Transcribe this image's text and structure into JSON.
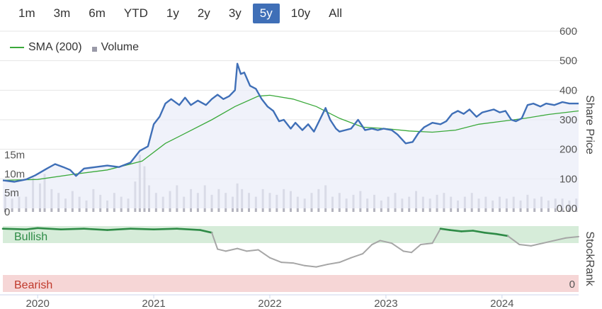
{
  "range_buttons": [
    "1m",
    "3m",
    "6m",
    "YTD",
    "1y",
    "2y",
    "3y",
    "5y",
    "10y",
    "All"
  ],
  "active_range": "5y",
  "legend": {
    "sma_label": "SMA (200)",
    "volume_label": "Volume"
  },
  "colors": {
    "price_line": "#3f6fb7",
    "sma_line": "#3aa93a",
    "volume_bars": "#9a9aa8",
    "bullish_band": "#d6ecd9",
    "bearish_band": "#f6d6d6",
    "bullish_text": "#2e8b46",
    "bearish_text": "#c0392b",
    "rank_bullish_line": "#2e8b46",
    "rank_neutral_line": "#a6a6a6"
  },
  "chart_data": {
    "type": "line",
    "right_axis_title": "Share Price",
    "right_axis_ticks": [
      "600",
      "500",
      "400",
      "300",
      "200",
      "100",
      "0.00"
    ],
    "ylim": [
      0,
      600
    ],
    "volume_axis_ticks": [
      "15m",
      "10m",
      "5m",
      "0"
    ],
    "volume_lim": [
      0,
      25
    ],
    "x_ticks": [
      "2020",
      "2021",
      "2022",
      "2023",
      "2024"
    ],
    "xlim": [
      2019.7,
      2024.66
    ],
    "price_series": {
      "points": [
        [
          2019.7,
          95
        ],
        [
          2019.8,
          90
        ],
        [
          2019.9,
          98
        ],
        [
          2019.98,
          112
        ],
        [
          2020.08,
          135
        ],
        [
          2020.15,
          150
        ],
        [
          2020.22,
          140
        ],
        [
          2020.28,
          130
        ],
        [
          2020.33,
          110
        ],
        [
          2020.4,
          135
        ],
        [
          2020.5,
          140
        ],
        [
          2020.6,
          145
        ],
        [
          2020.7,
          140
        ],
        [
          2020.8,
          155
        ],
        [
          2020.88,
          195
        ],
        [
          2020.95,
          210
        ],
        [
          2021.0,
          285
        ],
        [
          2021.05,
          310
        ],
        [
          2021.1,
          355
        ],
        [
          2021.15,
          370
        ],
        [
          2021.22,
          350
        ],
        [
          2021.27,
          375
        ],
        [
          2021.32,
          350
        ],
        [
          2021.38,
          365
        ],
        [
          2021.45,
          350
        ],
        [
          2021.5,
          370
        ],
        [
          2021.55,
          385
        ],
        [
          2021.6,
          370
        ],
        [
          2021.65,
          380
        ],
        [
          2021.7,
          400
        ],
        [
          2021.72,
          490
        ],
        [
          2021.75,
          455
        ],
        [
          2021.78,
          460
        ],
        [
          2021.83,
          415
        ],
        [
          2021.88,
          405
        ],
        [
          2021.93,
          370
        ],
        [
          2021.98,
          345
        ],
        [
          2022.03,
          330
        ],
        [
          2022.08,
          295
        ],
        [
          2022.12,
          300
        ],
        [
          2022.18,
          270
        ],
        [
          2022.22,
          290
        ],
        [
          2022.28,
          265
        ],
        [
          2022.33,
          285
        ],
        [
          2022.38,
          260
        ],
        [
          2022.43,
          300
        ],
        [
          2022.48,
          340
        ],
        [
          2022.52,
          300
        ],
        [
          2022.57,
          270
        ],
        [
          2022.6,
          260
        ],
        [
          2022.65,
          265
        ],
        [
          2022.7,
          270
        ],
        [
          2022.76,
          300
        ],
        [
          2022.82,
          265
        ],
        [
          2022.88,
          270
        ],
        [
          2022.93,
          265
        ],
        [
          2022.98,
          270
        ],
        [
          2023.05,
          265
        ],
        [
          2023.1,
          250
        ],
        [
          2023.17,
          220
        ],
        [
          2023.23,
          225
        ],
        [
          2023.28,
          255
        ],
        [
          2023.33,
          275
        ],
        [
          2023.4,
          290
        ],
        [
          2023.47,
          285
        ],
        [
          2023.52,
          295
        ],
        [
          2023.57,
          320
        ],
        [
          2023.62,
          330
        ],
        [
          2023.67,
          320
        ],
        [
          2023.72,
          335
        ],
        [
          2023.78,
          310
        ],
        [
          2023.83,
          325
        ],
        [
          2023.88,
          330
        ],
        [
          2023.93,
          335
        ],
        [
          2023.98,
          325
        ],
        [
          2024.03,
          330
        ],
        [
          2024.08,
          300
        ],
        [
          2024.12,
          295
        ],
        [
          2024.17,
          305
        ],
        [
          2024.22,
          350
        ],
        [
          2024.27,
          355
        ],
        [
          2024.33,
          345
        ],
        [
          2024.38,
          355
        ],
        [
          2024.45,
          350
        ],
        [
          2024.52,
          360
        ],
        [
          2024.58,
          355
        ],
        [
          2024.66,
          355
        ]
      ]
    },
    "sma_series": {
      "name": "SMA (200)",
      "points": [
        [
          2019.7,
          95
        ],
        [
          2020.0,
          98
        ],
        [
          2020.3,
          115
        ],
        [
          2020.6,
          130
        ],
        [
          2020.9,
          160
        ],
        [
          2021.1,
          220
        ],
        [
          2021.3,
          260
        ],
        [
          2021.5,
          300
        ],
        [
          2021.7,
          345
        ],
        [
          2021.9,
          380
        ],
        [
          2022.0,
          383
        ],
        [
          2022.2,
          370
        ],
        [
          2022.4,
          345
        ],
        [
          2022.6,
          305
        ],
        [
          2022.8,
          275
        ],
        [
          2023.0,
          270
        ],
        [
          2023.2,
          262
        ],
        [
          2023.4,
          258
        ],
        [
          2023.6,
          265
        ],
        [
          2023.8,
          285
        ],
        [
          2024.0,
          295
        ],
        [
          2024.2,
          305
        ],
        [
          2024.4,
          318
        ],
        [
          2024.66,
          330
        ]
      ]
    },
    "volume_series": {
      "name": "Volume",
      "points": [
        [
          2019.72,
          4.5
        ],
        [
          2019.78,
          3.5
        ],
        [
          2019.84,
          4.0
        ],
        [
          2019.9,
          4.0
        ],
        [
          2019.96,
          9.0
        ],
        [
          2020.02,
          7.5
        ],
        [
          2020.06,
          10.0
        ],
        [
          2020.12,
          6.0
        ],
        [
          2020.18,
          5.0
        ],
        [
          2020.24,
          3.5
        ],
        [
          2020.3,
          5.5
        ],
        [
          2020.36,
          4.0
        ],
        [
          2020.42,
          3.0
        ],
        [
          2020.48,
          6.0
        ],
        [
          2020.54,
          4.5
        ],
        [
          2020.6,
          3.0
        ],
        [
          2020.66,
          5.0
        ],
        [
          2020.72,
          4.0
        ],
        [
          2020.78,
          3.5
        ],
        [
          2020.84,
          8.0
        ],
        [
          2020.88,
          15.0
        ],
        [
          2020.92,
          12.0
        ],
        [
          2020.96,
          7.0
        ],
        [
          2021.02,
          5.0
        ],
        [
          2021.08,
          4.0
        ],
        [
          2021.14,
          5.5
        ],
        [
          2021.2,
          7.0
        ],
        [
          2021.26,
          4.0
        ],
        [
          2021.32,
          6.0
        ],
        [
          2021.38,
          5.0
        ],
        [
          2021.44,
          7.0
        ],
        [
          2021.5,
          4.5
        ],
        [
          2021.56,
          6.0
        ],
        [
          2021.62,
          5.0
        ],
        [
          2021.68,
          4.0
        ],
        [
          2021.72,
          7.5
        ],
        [
          2021.76,
          6.0
        ],
        [
          2021.82,
          5.0
        ],
        [
          2021.88,
          4.0
        ],
        [
          2021.94,
          6.0
        ],
        [
          2022.0,
          5.0
        ],
        [
          2022.06,
          4.5
        ],
        [
          2022.12,
          6.0
        ],
        [
          2022.18,
          5.5
        ],
        [
          2022.24,
          4.0
        ],
        [
          2022.3,
          3.5
        ],
        [
          2022.36,
          5.0
        ],
        [
          2022.42,
          6.0
        ],
        [
          2022.48,
          7.0
        ],
        [
          2022.54,
          4.0
        ],
        [
          2022.6,
          5.0
        ],
        [
          2022.66,
          3.5
        ],
        [
          2022.72,
          4.5
        ],
        [
          2022.78,
          5.5
        ],
        [
          2022.84,
          3.5
        ],
        [
          2022.9,
          4.5
        ],
        [
          2022.96,
          3.0
        ],
        [
          2023.02,
          4.0
        ],
        [
          2023.08,
          5.0
        ],
        [
          2023.14,
          3.5
        ],
        [
          2023.2,
          4.0
        ],
        [
          2023.26,
          5.5
        ],
        [
          2023.32,
          4.0
        ],
        [
          2023.38,
          3.5
        ],
        [
          2023.44,
          4.5
        ],
        [
          2023.5,
          5.0
        ],
        [
          2023.56,
          4.0
        ],
        [
          2023.62,
          3.0
        ],
        [
          2023.68,
          4.0
        ],
        [
          2023.74,
          5.0
        ],
        [
          2023.8,
          3.5
        ],
        [
          2023.86,
          4.0
        ],
        [
          2023.92,
          3.0
        ],
        [
          2023.98,
          4.0
        ],
        [
          2024.04,
          3.5
        ],
        [
          2024.1,
          4.0
        ],
        [
          2024.16,
          3.0
        ],
        [
          2024.22,
          4.5
        ],
        [
          2024.28,
          3.5
        ],
        [
          2024.34,
          4.0
        ],
        [
          2024.4,
          3.0
        ],
        [
          2024.46,
          3.5
        ],
        [
          2024.52,
          3.5
        ],
        [
          2024.58,
          3.0
        ],
        [
          2024.64,
          3.5
        ]
      ]
    },
    "stockrank": {
      "axis_title": "StockRank",
      "bullish_label": "Bullish",
      "bearish_label": "Bearish",
      "top_value": "100",
      "bottom_value": "0",
      "ylim": [
        0,
        100
      ],
      "points": [
        [
          2019.7,
          96
        ],
        [
          2019.9,
          95
        ],
        [
          2020.0,
          97
        ],
        [
          2020.2,
          95
        ],
        [
          2020.4,
          96
        ],
        [
          2020.6,
          94
        ],
        [
          2020.8,
          96
        ],
        [
          2021.0,
          95
        ],
        [
          2021.2,
          96
        ],
        [
          2021.4,
          94
        ],
        [
          2021.5,
          90
        ],
        [
          2021.55,
          65
        ],
        [
          2021.62,
          62
        ],
        [
          2021.72,
          66
        ],
        [
          2021.8,
          62
        ],
        [
          2021.9,
          64
        ],
        [
          2022.0,
          52
        ],
        [
          2022.1,
          45
        ],
        [
          2022.2,
          44
        ],
        [
          2022.3,
          40
        ],
        [
          2022.4,
          38
        ],
        [
          2022.5,
          42
        ],
        [
          2022.6,
          45
        ],
        [
          2022.7,
          52
        ],
        [
          2022.8,
          58
        ],
        [
          2022.88,
          72
        ],
        [
          2022.95,
          78
        ],
        [
          2023.05,
          74
        ],
        [
          2023.15,
          62
        ],
        [
          2023.22,
          60
        ],
        [
          2023.3,
          72
        ],
        [
          2023.4,
          74
        ],
        [
          2023.47,
          96
        ],
        [
          2023.55,
          94
        ],
        [
          2023.65,
          92
        ],
        [
          2023.75,
          93
        ],
        [
          2023.85,
          90
        ],
        [
          2023.95,
          88
        ],
        [
          2024.05,
          85
        ],
        [
          2024.15,
          72
        ],
        [
          2024.25,
          70
        ],
        [
          2024.35,
          74
        ],
        [
          2024.45,
          78
        ],
        [
          2024.55,
          82
        ],
        [
          2024.66,
          84
        ]
      ]
    }
  }
}
